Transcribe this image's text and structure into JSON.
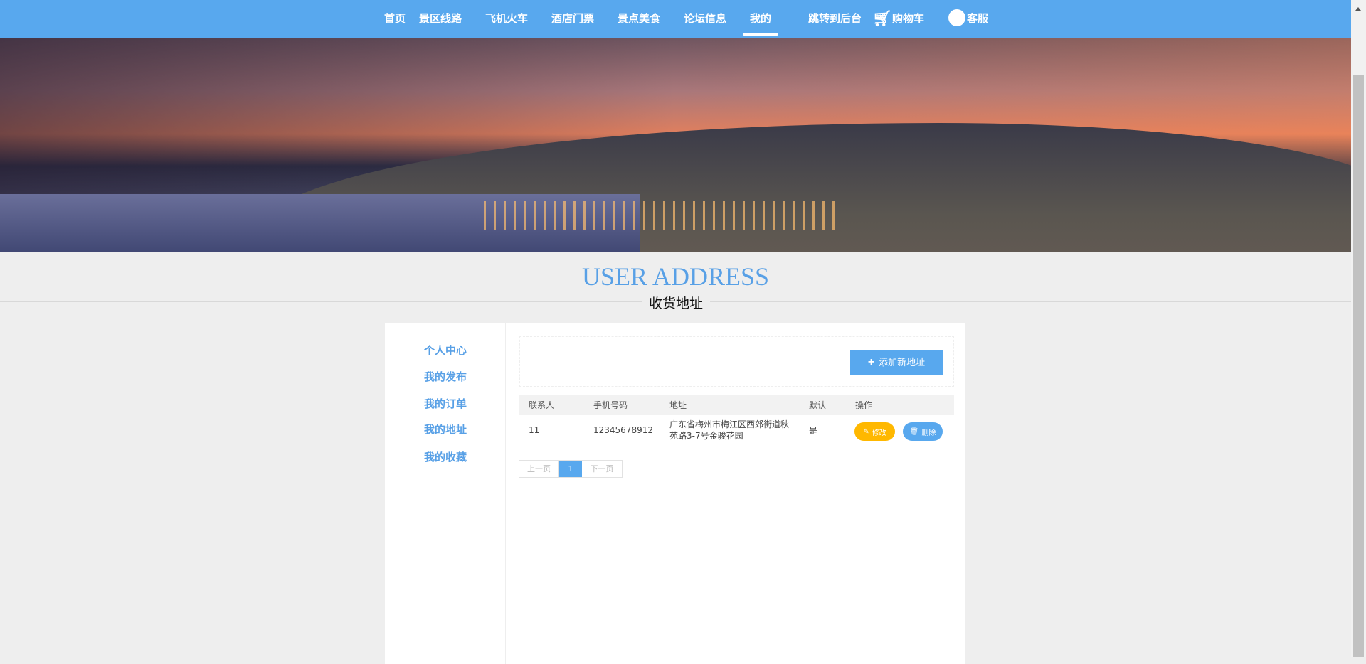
{
  "nav": {
    "items": [
      "首页",
      "景区线路",
      "飞机火车",
      "酒店门票",
      "景点美食",
      "论坛信息",
      "我的",
      "跳转到后台"
    ],
    "cart": "购物车",
    "service": "客服",
    "active": "我的"
  },
  "header": {
    "title": "USER ADDRESS",
    "subtitle": "收货地址"
  },
  "sidebar": {
    "items": [
      "个人中心",
      "我的发布",
      "我的订单",
      "我的地址",
      "我的收藏"
    ]
  },
  "toolbar": {
    "add_label": "添加新地址"
  },
  "table": {
    "headers": [
      "联系人",
      "手机号码",
      "地址",
      "默认",
      "操作"
    ],
    "rows": [
      {
        "contact": "11",
        "phone": "12345678912",
        "address": "广东省梅州市梅江区西郊街道秋苑路3-7号金骏花园",
        "default": "是",
        "edit": "修改",
        "delete": "删除"
      }
    ]
  },
  "pagination": {
    "prev": "上一页",
    "current": "1",
    "next": "下一页"
  },
  "colors": {
    "accent": "#58a8ee",
    "edit": "#ffb800"
  }
}
